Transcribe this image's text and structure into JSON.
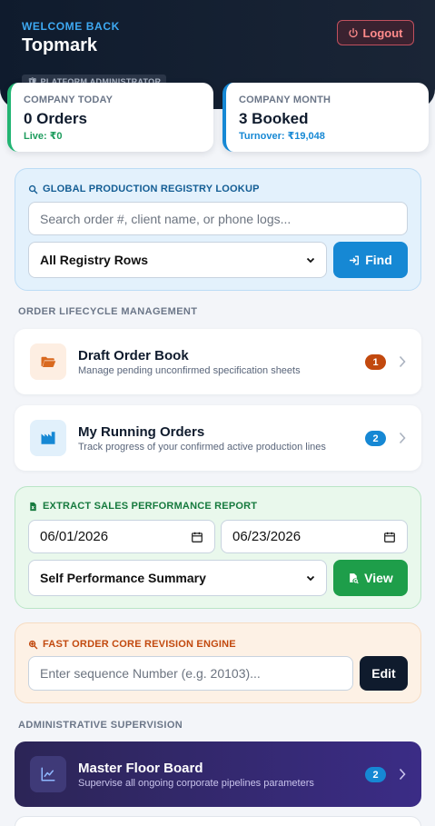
{
  "header": {
    "welcome": "WELCOME BACK",
    "user_name": "Topmark",
    "role_badge": "🛡 PLATFORM ADMINISTRATOR",
    "logout_label": "Logout"
  },
  "stats": {
    "today": {
      "label": "COMPANY TODAY",
      "value": "0 Orders",
      "sub": "Live: ₹0"
    },
    "month": {
      "label": "COMPANY MONTH",
      "value": "3 Booked",
      "sub": "Turnover: ₹19,048"
    }
  },
  "registry": {
    "title": "GLOBAL PRODUCTION REGISTRY LOOKUP",
    "search_placeholder": "Search order #, client name, or phone logs...",
    "filter_value": "All Registry Rows",
    "find_label": "Find"
  },
  "lifecycle": {
    "heading": "ORDER LIFECYCLE MANAGEMENT",
    "items": [
      {
        "title": "Draft Order Book",
        "desc": "Manage pending unconfirmed specification sheets",
        "count": "1",
        "icon": "folder-open-icon",
        "badge_color": "#c2490e",
        "icon_bg": "#fdeee2",
        "icon_color": "#d9691f"
      },
      {
        "title": "My Running Orders",
        "desc": "Track progress of your confirmed active production lines",
        "count": "2",
        "icon": "factory-icon",
        "badge_color": "#1688d4",
        "icon_bg": "#e1f0fb",
        "icon_color": "#1688d4"
      }
    ]
  },
  "report": {
    "title": "EXTRACT SALES PERFORMANCE REPORT",
    "start_date": "06/01/2026",
    "end_date": "06/23/2026",
    "report_type": "Self Performance Summary",
    "view_label": "View"
  },
  "revision": {
    "title": "FAST ORDER CORE REVISION ENGINE",
    "seq_placeholder": "Enter sequence Number (e.g. 20103)...",
    "edit_label": "Edit"
  },
  "admin": {
    "heading": "ADMINISTRATIVE SUPERVISION",
    "master": {
      "title": "Master Floor Board",
      "desc": "Supervise all ongoing corporate pipelines parameters",
      "count": "2",
      "icon": "chart-line-icon",
      "badge_color": "#1688d4"
    }
  }
}
